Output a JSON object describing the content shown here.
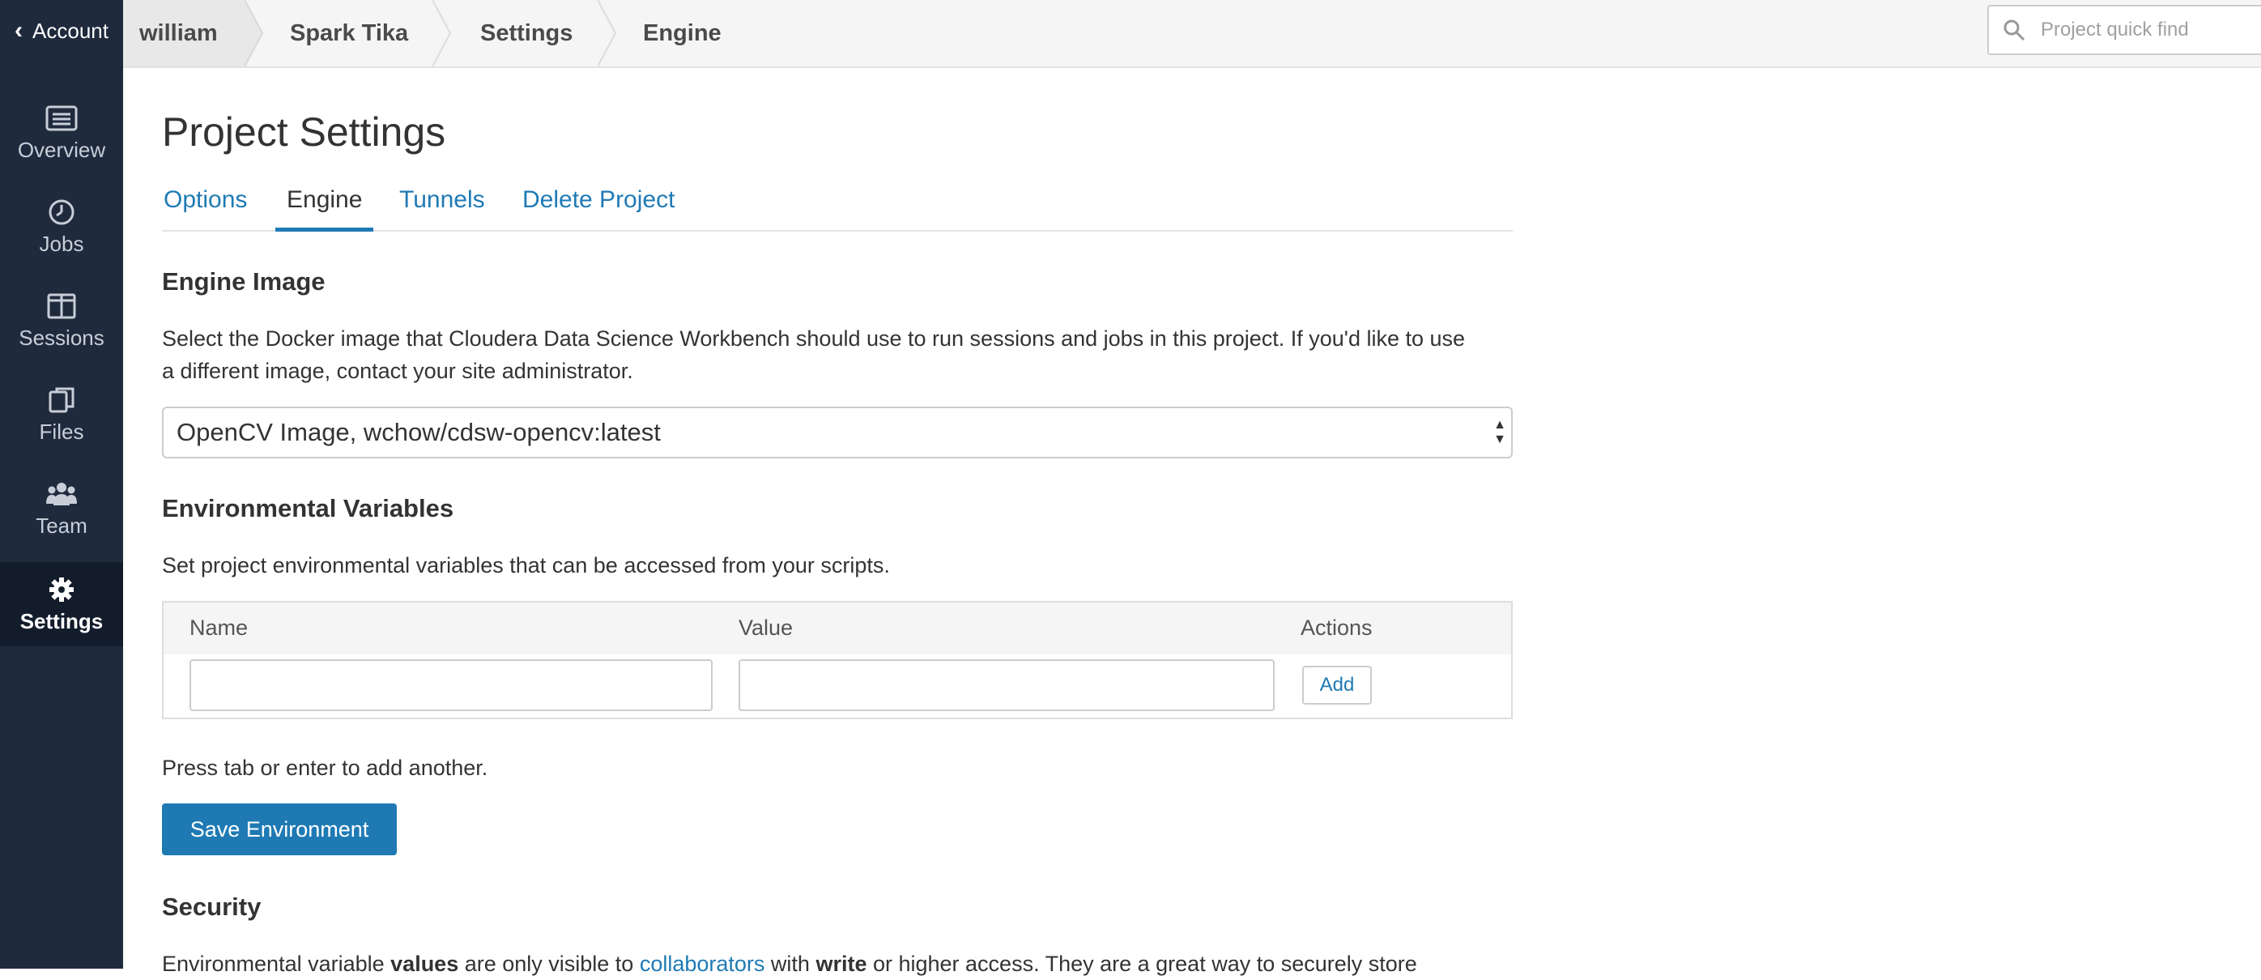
{
  "sidebar": {
    "account_label": "Account",
    "items": [
      {
        "label": "Overview",
        "icon": "list-icon"
      },
      {
        "label": "Jobs",
        "icon": "clock-icon"
      },
      {
        "label": "Sessions",
        "icon": "columns-icon"
      },
      {
        "label": "Files",
        "icon": "files-icon"
      },
      {
        "label": "Team",
        "icon": "team-icon"
      },
      {
        "label": "Settings",
        "icon": "gear-icon",
        "active": true
      }
    ]
  },
  "breadcrumb": [
    "william",
    "Spark Tika",
    "Settings",
    "Engine"
  ],
  "search": {
    "placeholder": "Project quick find",
    "value": ""
  },
  "page": {
    "title": "Project Settings",
    "tabs": [
      {
        "label": "Options",
        "active": false
      },
      {
        "label": "Engine",
        "active": true
      },
      {
        "label": "Tunnels",
        "active": false
      },
      {
        "label": "Delete Project",
        "active": false
      }
    ]
  },
  "engine_image": {
    "title": "Engine Image",
    "description_1": "Select the Docker image that Cloudera Data Science Workbench should use to run sessions and jobs in this project. If you'd like to use",
    "description_2": "a different image, contact your site administrator.",
    "selected": "OpenCV Image, wchow/cdsw-opencv:latest"
  },
  "env_vars": {
    "title": "Environmental Variables",
    "description": "Set project environmental variables that can be accessed from your scripts.",
    "columns": [
      "Name",
      "Value",
      "Actions"
    ],
    "name_value": "",
    "value_value": "",
    "add_label": "Add",
    "hint": "Press tab or enter to add another.",
    "save_label": "Save Environment"
  },
  "security": {
    "title": "Security",
    "text_1": "Environmental variable ",
    "text_bold_1": "values",
    "text_2": " are only visible to ",
    "link": "collaborators",
    "text_3": " with ",
    "text_bold_2": "write",
    "text_4": " or higher access. They are a great way to securely store"
  },
  "colors": {
    "accent": "#1f7ab4",
    "sidebar": "#1f2a3d",
    "sidebar_active": "#131c2b"
  }
}
